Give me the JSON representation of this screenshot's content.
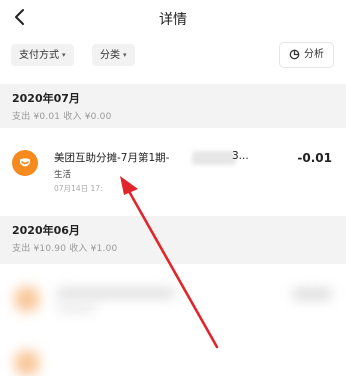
{
  "header": {
    "title": "详情",
    "back_icon": "chevron-left-icon"
  },
  "filters": {
    "payment_label": "支付方式",
    "category_label": "分类",
    "caret": "▾",
    "analyze_label": "分析",
    "analyze_icon": "pie-chart-icon"
  },
  "months": [
    {
      "title": "2020年07月",
      "summary": "支出 ¥0.01   收入 ¥0.00"
    },
    {
      "title": "2020年06月",
      "summary": "支出 ¥10.90   收入 ¥1.00"
    }
  ],
  "record": {
    "title": "美团互助分摊-7月第1期-",
    "title_tail": "3...",
    "category": "生活",
    "time": "07月14日 17:",
    "amount": "-0.01",
    "logo_icon": "meituan-logo-icon"
  },
  "colors": {
    "accent": "#f58a1f",
    "annotation_arrow": "#e0262b"
  }
}
